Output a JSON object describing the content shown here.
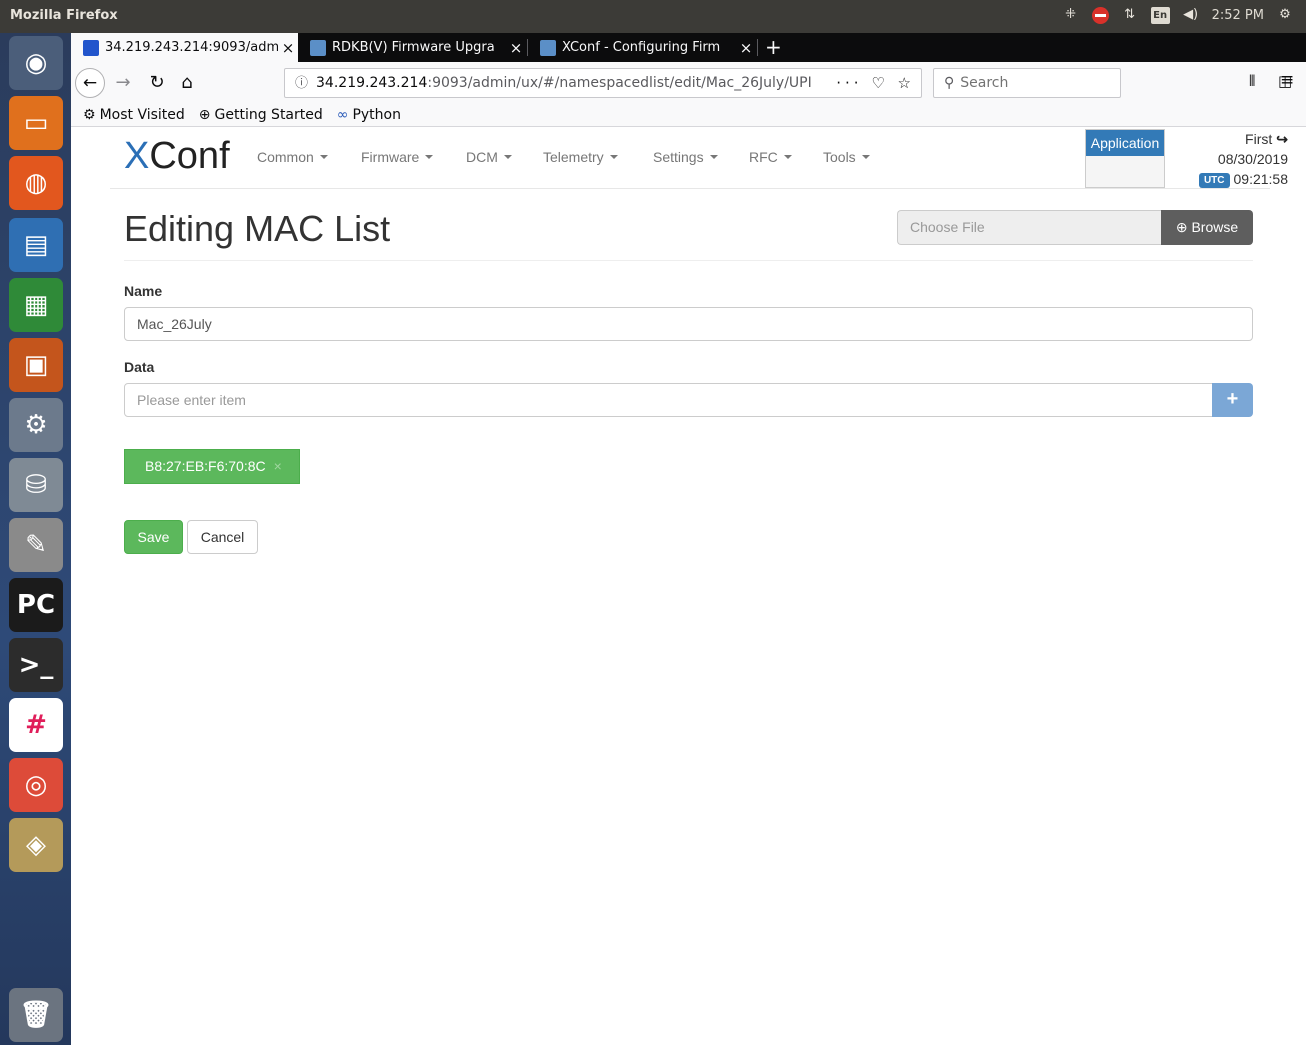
{
  "os": {
    "app_title": "Mozilla Firefox",
    "keyboard_layout": "En",
    "clock": "2:52 PM",
    "launcher_items": [
      {
        "name": "ubuntu-dash-icon",
        "color": "#4b5e7a",
        "glyph": "◉"
      },
      {
        "name": "files-icon",
        "color": "#e0701d",
        "glyph": "▭"
      },
      {
        "name": "firefox-icon",
        "color": "#e2571e",
        "glyph": "◍"
      },
      {
        "name": "writer-icon",
        "color": "#2f6fb3",
        "glyph": "▤"
      },
      {
        "name": "calc-icon",
        "color": "#2f8a38",
        "glyph": "▦"
      },
      {
        "name": "impress-icon",
        "color": "#c4551c",
        "glyph": "▣"
      },
      {
        "name": "system-settings-icon",
        "color": "#6c7a8c",
        "glyph": "⚙"
      },
      {
        "name": "disk-utility-icon",
        "color": "#7f8a95",
        "glyph": "⛁"
      },
      {
        "name": "text-editor-icon",
        "color": "#8a8a8a",
        "glyph": "✎"
      },
      {
        "name": "pycharm-icon",
        "color": "#1b1b1b",
        "glyph": "PC"
      },
      {
        "name": "terminal-icon",
        "color": "#2c2c2c",
        "glyph": ">_"
      },
      {
        "name": "slack-icon",
        "color": "#ffffff",
        "glyph": "#"
      },
      {
        "name": "chrome-icon",
        "color": "#dd4b39",
        "glyph": "◎"
      },
      {
        "name": "screenshot-icon",
        "color": "#b49a5a",
        "glyph": "◈"
      },
      {
        "name": "trash-icon",
        "color": "#6b7480",
        "glyph": "🗑"
      }
    ]
  },
  "browser": {
    "tabs": [
      {
        "title": "34.219.243.214:9093/adm",
        "favicon_color": "#2255cc"
      },
      {
        "title": "RDKB(V) Firmware Upgra",
        "favicon_color": "#5b8fc7"
      },
      {
        "title": "XConf - Configuring Firm",
        "favicon_color": "#5b8fc7"
      }
    ],
    "url_host": "34.219.243.214",
    "url_rest": ":9093/admin/ux/#/namespacedlist/edit/Mac_26July/UPI",
    "url_icons": "··· ♡ ☆",
    "search_placeholder": "Search",
    "bookmarks": [
      {
        "label": "Most Visited",
        "icon": "⚙"
      },
      {
        "label": "Getting Started",
        "icon": "⊕"
      },
      {
        "label": "Python",
        "icon": "∞"
      }
    ]
  },
  "app": {
    "logo_x": "X",
    "logo_rest": "Conf",
    "menus": [
      "Common",
      "Firmware",
      "DCM",
      "Telemetry",
      "Settings",
      "RFC",
      "Tools"
    ],
    "application_label": "Application",
    "user_name": "First",
    "date": "08/30/2019",
    "utc_label": "UTC",
    "time": "09:21:58"
  },
  "page": {
    "title": "Editing MAC List",
    "choose_file": "Choose File",
    "browse_label": "Browse",
    "name_label": "Name",
    "name_value": "Mac_26July",
    "data_label": "Data",
    "data_placeholder": "Please enter item",
    "items": [
      "B8:27:EB:F6:70:8C"
    ],
    "save_label": "Save",
    "cancel_label": "Cancel"
  }
}
